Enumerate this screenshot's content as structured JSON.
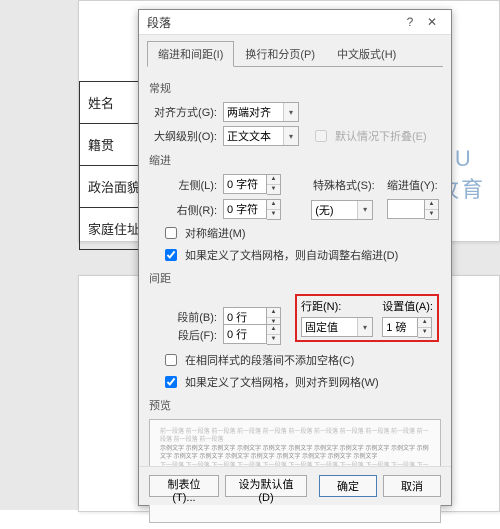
{
  "doc": {
    "cells": [
      "姓名",
      "籍贯",
      "政治面貌",
      "家庭住址"
    ],
    "watermark_line1": "UU",
    "watermark_line2": "牧育"
  },
  "dialog": {
    "title": "段落",
    "help": "?",
    "tabs": [
      "缩进和间距(I)",
      "换行和分页(P)",
      "中文版式(H)"
    ],
    "general": {
      "title": "常规",
      "align_label": "对齐方式(G):",
      "align_value": "两端对齐",
      "outline_label": "大纲级别(O):",
      "outline_value": "正文文本",
      "collapsed_label": "默认情况下折叠(E)"
    },
    "indent": {
      "title": "缩进",
      "left_label": "左侧(L):",
      "left_value": "0 字符",
      "right_label": "右侧(R):",
      "right_value": "0 字符",
      "special_label": "特殊格式(S):",
      "special_value": "(无)",
      "by_label": "缩进值(Y):",
      "sym_label": "对称缩进(M)",
      "auto_label": "如果定义了文档网格，则自动调整右缩进(D)"
    },
    "spacing": {
      "title": "间距",
      "before_label": "段前(B):",
      "before_value": "0 行",
      "after_label": "段后(F):",
      "after_value": "0 行",
      "line_label": "行距(N):",
      "line_value": "固定值",
      "at_label": "设置值(A):",
      "at_value": "1 磅",
      "nospace_label": "在相同样式的段落间不添加空格(C)",
      "snap_label": "如果定义了文档网格，则对齐到网格(W)"
    },
    "preview": {
      "title": "预览",
      "grey": "前一段落 前一段落 前一段落 前一段落 前一段落 前一段落 前一段落 前一段落 前一段落 前一段落 前一段落 前一段落 前一段落",
      "dark": "示例文字 示例文字 示例文字 示例文字 示例文字 示例文字 示例文字 示例文字 示例文字 示例文字 示例文字 示例文字 示例文字 示例文字 示例文字 示例文字 示例文字 示例文字 示例文字",
      "grey2": "下一段落 下一段落 下一段落 下一段落 下一段落 下一段落 下一段落 下一段落 下一段落 下一段落 下一段落 下一段落"
    },
    "buttons": {
      "tabs": "制表位(T)...",
      "default": "设为默认值(D)",
      "ok": "确定",
      "cancel": "取消"
    }
  }
}
